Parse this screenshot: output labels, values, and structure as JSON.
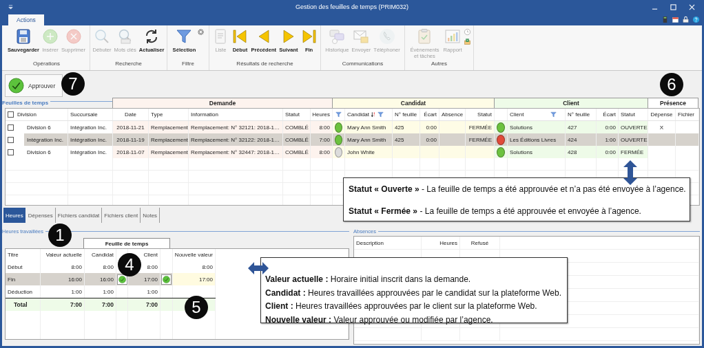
{
  "window": {
    "title": "Gestion des feuilles de temps (PRIM032)"
  },
  "ribbon_tabs": [
    {
      "label": "Actions",
      "selected": true
    }
  ],
  "ribbon_groups": [
    {
      "label": "Opérations",
      "buttons": [
        {
          "label": "Sauvegarder",
          "disabled": false
        },
        {
          "label": "Insérer",
          "disabled": true
        },
        {
          "label": "Supprimer",
          "disabled": true
        }
      ]
    },
    {
      "label": "Recherche",
      "buttons": [
        {
          "label": "Débuter",
          "disabled": true
        },
        {
          "label": "Mots clés",
          "disabled": true
        },
        {
          "label": "Actualiser",
          "disabled": false
        }
      ]
    },
    {
      "label": "Filtre",
      "buttons": [
        {
          "label": "Sélection",
          "disabled": false
        }
      ]
    },
    {
      "label": "Résultats de recherche",
      "buttons": [
        {
          "label": "Liste",
          "disabled": true
        },
        {
          "label": "Début",
          "disabled": false
        },
        {
          "label": "Précédent",
          "disabled": false
        },
        {
          "label": "Suivant",
          "disabled": false
        },
        {
          "label": "Fin",
          "disabled": false
        }
      ]
    },
    {
      "label": "Communications",
      "buttons": [
        {
          "label": "Historique",
          "disabled": true
        },
        {
          "label": "Envoyer",
          "disabled": true
        },
        {
          "label": "Téléphoner",
          "disabled": true
        }
      ]
    },
    {
      "label": "Autres",
      "buttons": [
        {
          "label": "Évènements et tâches",
          "disabled": true
        },
        {
          "label": "Rapport",
          "disabled": true
        }
      ]
    }
  ],
  "approve_button": {
    "label": "Approuver"
  },
  "timesheets": {
    "label": "Feuilles de temps",
    "all_checked": false,
    "groups": [
      {
        "label": "Demande",
        "color": "#fdf3ee"
      },
      {
        "label": "Candidat",
        "color": "#fefce6"
      },
      {
        "label": "Client",
        "color": "#eefbe8"
      },
      {
        "label": "Présence",
        "color": "#ffffff"
      }
    ],
    "columns": [
      {
        "label": "Division",
        "filtered": false,
        "sorted": false
      },
      {
        "label": "Succursale",
        "filtered": false,
        "sorted": false
      },
      {
        "label": "Date",
        "filtered": false,
        "sorted": false
      },
      {
        "label": "Type",
        "filtered": false,
        "sorted": false
      },
      {
        "label": "Information",
        "filtered": false,
        "sorted": false
      },
      {
        "label": "Statut",
        "filtered": false,
        "sorted": false
      },
      {
        "label": "Heures",
        "filtered": false,
        "sorted": false
      },
      {
        "filtered": true,
        "sorted": false
      },
      {
        "label": "Candidat",
        "filtered": true,
        "sorted": true
      },
      {
        "label": "N° feuille",
        "filtered": false,
        "sorted": false
      },
      {
        "label": "Écart",
        "filtered": false,
        "sorted": false
      },
      {
        "label": "Absence",
        "filtered": false,
        "sorted": false
      },
      {
        "label": "Statut",
        "filtered": false,
        "sorted": false
      },
      {
        "filtered": false,
        "sorted": false
      },
      {
        "label": "Client",
        "filtered": true,
        "sorted": false
      },
      {
        "label": "N° feuille",
        "filtered": false,
        "sorted": false
      },
      {
        "label": "Écart",
        "filtered": false,
        "sorted": false
      },
      {
        "label": "Statut",
        "filtered": false,
        "sorted": false
      },
      {
        "label": "Dépense",
        "filtered": false,
        "sorted": false
      },
      {
        "label": "Fichier",
        "filtered": false,
        "sorted": false
      }
    ],
    "rows": [
      {
        "checked": false,
        "selected": false,
        "division": "Division 6",
        "succursale": "Intégration Inc.",
        "date": "2018-11-21",
        "type": "Remplacement",
        "information": "Remplacement: N° 32121: 2018-1…",
        "statut": "COMBLÉ",
        "heures": "8:00",
        "candidate_dot": {
          "color": "#6cc23f"
        },
        "candidat": "Mary Ann Smith",
        "candidate_sheet": "425",
        "candidate_gap": "0:00",
        "candidate_status": "FERMÉE",
        "client_dot": {
          "color": "#6cc23f"
        },
        "client": "Solutions",
        "client_sheet": "427",
        "client_gap": "0:00",
        "client_status": "OUVERTE",
        "expense": "X"
      },
      {
        "checked": false,
        "selected": true,
        "division": "Intégration Inc.",
        "succursale": "Intégration Inc.",
        "date": "2018-11-19",
        "type": "Remplacement",
        "information": "Remplacement: N° 32122: 2018-1…",
        "statut": "COMBLÉ",
        "heures": "7:00",
        "candidate_dot": {
          "color": "#6cc23f"
        },
        "candidat": "Mary Ann Smith",
        "candidate_sheet": "425",
        "candidate_gap": "0:00",
        "candidate_status": "FERMÉE",
        "client_dot": {
          "color": "#e04b3a"
        },
        "client": "Les Éditions Livres",
        "client_sheet": "424",
        "client_gap": "1:00",
        "client_status": "OUVERTE"
      },
      {
        "checked": false,
        "selected": false,
        "division": "Division 6",
        "succursale": "Intégration Inc.",
        "date": "2018-11-07",
        "type": "Remplacement",
        "information": "Remplacement: N° 32447: 2018-1…",
        "statut": "COMBLÉ",
        "heures": "8:00",
        "candidate_dot": {
          "color": "#dcdcdc"
        },
        "candidat": "John White",
        "client_dot": {
          "color": "#6cc23f"
        },
        "client": "Solutions",
        "client_sheet": "428",
        "client_gap": "0:00",
        "client_status": "FERMÉE"
      }
    ]
  },
  "detail_tabs": [
    {
      "label": "Heures",
      "selected": true
    },
    {
      "label": "Dépenses",
      "selected": false
    },
    {
      "label": "Fichiers candidat",
      "selected": false
    },
    {
      "label": "Fichiers client",
      "selected": false
    },
    {
      "label": "Notes",
      "selected": false
    }
  ],
  "hours": {
    "label": "Heures travaillées",
    "header": "Feuille de temps",
    "columns": [
      "Titre",
      "Valeur actuelle",
      "Candidat",
      "Client",
      "Nouvelle valeur"
    ],
    "rows": [
      {
        "kind": "value",
        "selected": false,
        "title": "Début",
        "current": "8:00",
        "candidate": "8:00",
        "candidate_approved": false,
        "client": "8:00",
        "client_approved": false,
        "new_value": "8:00"
      },
      {
        "kind": "value",
        "selected": true,
        "title": "Fin",
        "current": "16:00",
        "candidate": "16:00",
        "candidate_approved": true,
        "client": "17:00",
        "client_approved": true,
        "new_value": "17:00"
      },
      {
        "kind": "value",
        "selected": false,
        "title": "Déduction",
        "current": "1:00",
        "candidate": "1:00",
        "candidate_approved": false,
        "client": "1:00",
        "client_approved": false
      },
      {
        "kind": "total",
        "selected": false,
        "title": "Total",
        "current": "7:00",
        "candidate": "7:00",
        "candidate_approved": false,
        "client": "7:00",
        "client_approved": false
      }
    ]
  },
  "absences": {
    "label": "Absences",
    "columns": [
      "Description",
      "Heures",
      "Refusé"
    ]
  },
  "annotations": {
    "badges": [
      {
        "label": "7"
      },
      {
        "label": "6"
      },
      {
        "label": "1"
      },
      {
        "label": "4"
      },
      {
        "label": "5"
      }
    ],
    "callouts": [
      {
        "lines": [
          "**Statut « Ouverte »** - La feuille de temps a été approuvée et n’a pas été envoyée à l’agence.",
          "**Statut « Fermée »** - La feuille de temps a été approuvée et envoyée à l’agence."
        ]
      },
      {
        "lines": [
          "**Valeur actuelle :** Horaire initial inscrit dans la demande.",
          "**Candidat :** Heures travaillées approuvées par le candidat sur la plateforme Web.",
          "**Client :** Heures travaillées approuvées par le client sur la plateforme Web.",
          "**Nouvelle valeur :** Valeur approuvée ou modifiée par l’agence."
        ]
      }
    ]
  }
}
